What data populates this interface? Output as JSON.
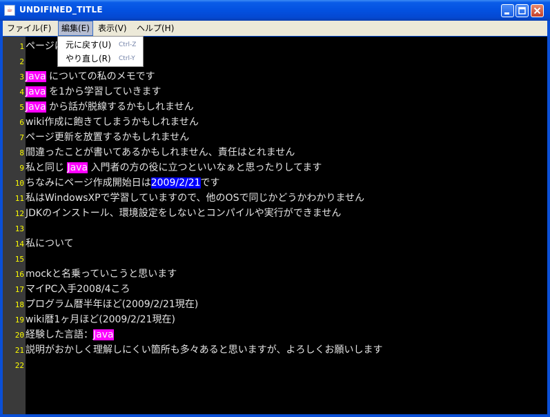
{
  "window": {
    "title": "UNDIFINED_TITLE",
    "icon": "java-cup-icon"
  },
  "menubar": [
    {
      "label": "ファイル(F)",
      "active": false
    },
    {
      "label": "編集(E)",
      "active": true
    },
    {
      "label": "表示(V)",
      "active": false
    },
    {
      "label": "ヘルプ(H)",
      "active": false
    }
  ],
  "edit_menu": [
    {
      "label": "元に戻す(U)",
      "shortcut": "Ctrl-Z"
    },
    {
      "label": "やり直し(R)",
      "shortcut": "Ctrl-Y"
    }
  ],
  "editor": {
    "lines": [
      {
        "num": "1",
        "parts": [
          {
            "t": "ページについて"
          }
        ]
      },
      {
        "num": "2",
        "parts": []
      },
      {
        "num": "3",
        "parts": [
          {
            "t": "Java",
            "hl": "java"
          },
          {
            "t": " についての私のメモです"
          }
        ]
      },
      {
        "num": "4",
        "parts": [
          {
            "t": "Java",
            "hl": "java"
          },
          {
            "t": " を1から学習していきます"
          }
        ]
      },
      {
        "num": "5",
        "parts": [
          {
            "t": "Java",
            "hl": "java"
          },
          {
            "t": " から話が脱線するかもしれません"
          }
        ]
      },
      {
        "num": "6",
        "parts": [
          {
            "t": "wiki作成に飽きてしまうかもしれません"
          }
        ]
      },
      {
        "num": "7",
        "parts": [
          {
            "t": "ページ更新を放置するかもしれません"
          }
        ]
      },
      {
        "num": "8",
        "parts": [
          {
            "t": "間違ったことが書いてあるかもしれません、責任はとれません"
          }
        ]
      },
      {
        "num": "9",
        "parts": [
          {
            "t": "私と同じ "
          },
          {
            "t": "Java",
            "hl": "java"
          },
          {
            "t": " 入門者の方の役に立つといいなぁと思ったりしてます"
          }
        ]
      },
      {
        "num": "10",
        "parts": [
          {
            "t": "ちなみにページ作成開始日は"
          },
          {
            "t": "2009/2/21",
            "hl": "date"
          },
          {
            "t": "です"
          }
        ]
      },
      {
        "num": "11",
        "parts": [
          {
            "t": "私はWindowsXPで学習していますので、他のOSで同じかどうかわかりません"
          }
        ]
      },
      {
        "num": "12",
        "parts": [
          {
            "t": "JDKのインストール、環境設定をしないとコンパイルや実行ができません"
          }
        ]
      },
      {
        "num": "13",
        "parts": []
      },
      {
        "num": "14",
        "parts": [
          {
            "t": "私について"
          }
        ]
      },
      {
        "num": "15",
        "parts": []
      },
      {
        "num": "16",
        "parts": [
          {
            "t": "mockと名乗っていこうと思います"
          }
        ]
      },
      {
        "num": "17",
        "parts": [
          {
            "t": "マイPC入手2008/4ころ"
          }
        ]
      },
      {
        "num": "18",
        "parts": [
          {
            "t": "プログラム暦半年ほど(2009/2/21現在)"
          }
        ]
      },
      {
        "num": "19",
        "parts": [
          {
            "t": "wiki暦1ヶ月ほど(2009/2/21現在)"
          }
        ]
      },
      {
        "num": "20",
        "parts": [
          {
            "t": "経験した言語："
          },
          {
            "t": "Java",
            "hl": "java"
          }
        ]
      },
      {
        "num": "21",
        "parts": [
          {
            "t": "説明がおかしく理解しにくい箇所も多々あると思いますが、よろしくお願いします"
          }
        ]
      },
      {
        "num": "22",
        "parts": []
      }
    ]
  },
  "colors": {
    "java_highlight": "#ff00ff",
    "date_highlight": "#0000ff",
    "line_number": "#ffff00",
    "editor_bg": "#000000"
  }
}
